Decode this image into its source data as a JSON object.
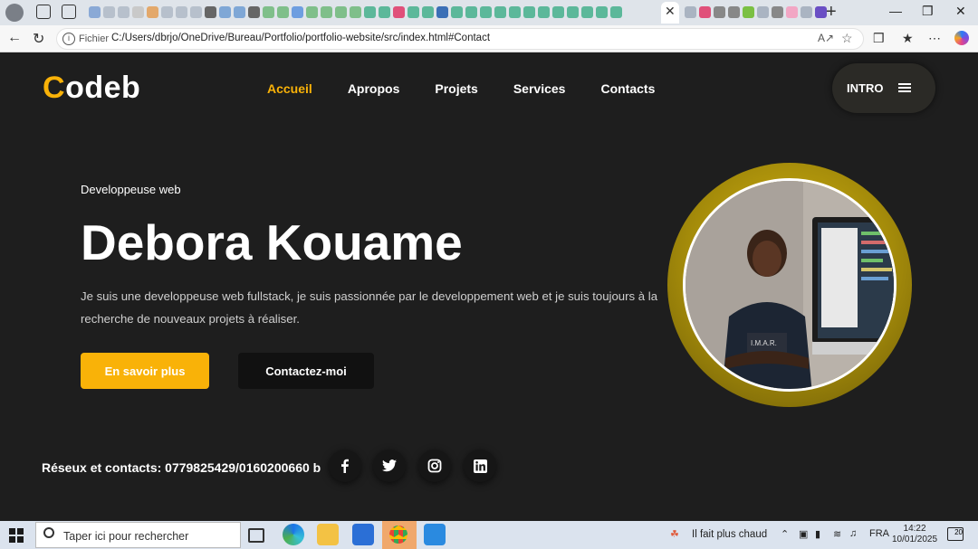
{
  "browser": {
    "address_scheme": "Fichier",
    "address_path": "C:/Users/dbrjo/OneDrive/Bureau/Portfolio/portfolio-website/src/index.html#Contact",
    "close_tab_glyph": "✕",
    "new_tab_glyph": "+",
    "window_controls": [
      "—",
      "❐",
      "✕"
    ]
  },
  "site": {
    "logo_initial": "C",
    "logo_rest": "odeb",
    "nav": [
      {
        "label": "Accueil",
        "active": true
      },
      {
        "label": "Apropos",
        "active": false
      },
      {
        "label": "Projets",
        "active": false
      },
      {
        "label": "Services",
        "active": false
      },
      {
        "label": "Contacts",
        "active": false
      }
    ],
    "intro_label": "INTRO",
    "hero": {
      "subtitle": "Developpeuse web",
      "name": "Debora Kouame",
      "description": "Je suis une developpeuse web fullstack, je suis passionnée par le developpement web et je suis toujours à la recherche de nouveaux projets à réaliser.",
      "primary_button": "En savoir plus",
      "secondary_button": "Contactez-moi"
    },
    "social_text": "Réseux et contacts: 0779825429/0160200660 b",
    "social_icons": [
      "facebook-icon",
      "twitter-icon",
      "instagram-icon",
      "linkedin-icon"
    ],
    "colors": {
      "accent": "#f9b208",
      "background": "#1e1e1e"
    }
  },
  "taskbar": {
    "search_placeholder": "Taper ici pour rechercher",
    "weather": "Il fait plus chaud",
    "language": "FRA",
    "time": "14:22",
    "date": "10/01/2025",
    "notification_count": "20"
  }
}
